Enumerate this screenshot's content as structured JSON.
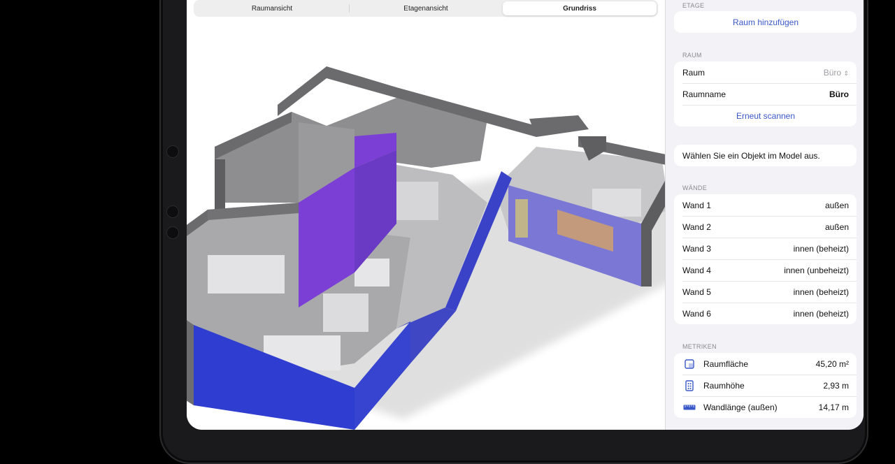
{
  "tabs": [
    {
      "label": "Raumansicht",
      "active": false
    },
    {
      "label": "Etagenansicht",
      "active": false
    },
    {
      "label": "Grundriss",
      "active": true
    }
  ],
  "panel": {
    "etage": {
      "section": "ETAGE",
      "add_room": "Raum hinzufügen"
    },
    "raum": {
      "section": "RAUM",
      "room_label": "Raum",
      "room_value": "Büro",
      "room_name_label": "Raumname",
      "room_name_value": "Büro",
      "rescan": "Erneut scannen"
    },
    "hint": "Wählen Sie ein Objekt im Model aus.",
    "walls": {
      "section": "WÄNDE",
      "items": [
        {
          "label": "Wand 1",
          "value": "außen"
        },
        {
          "label": "Wand 2",
          "value": "außen"
        },
        {
          "label": "Wand 3",
          "value": "innen (beheizt)"
        },
        {
          "label": "Wand 4",
          "value": "innen (unbeheizt)"
        },
        {
          "label": "Wand 5",
          "value": "innen (beheizt)"
        },
        {
          "label": "Wand 6",
          "value": "innen (beheizt)"
        }
      ]
    },
    "metrics": {
      "section": "METRIKEN",
      "items": [
        {
          "label": "Raumfläche",
          "value": "45,20 m²",
          "icon": "area-icon"
        },
        {
          "label": "Raumhöhe",
          "value": "2,93 m",
          "icon": "height-icon"
        },
        {
          "label": "Wandlänge (außen)",
          "value": "14,17 m",
          "icon": "ruler-icon"
        }
      ]
    }
  },
  "colors": {
    "accent_blue": "#3a57c8",
    "wall_blue": "#2f3ed0",
    "wall_purple": "#7c3fd6",
    "wall_lavender": "#7a78d4",
    "wall_gray": "#6b6b6e"
  }
}
